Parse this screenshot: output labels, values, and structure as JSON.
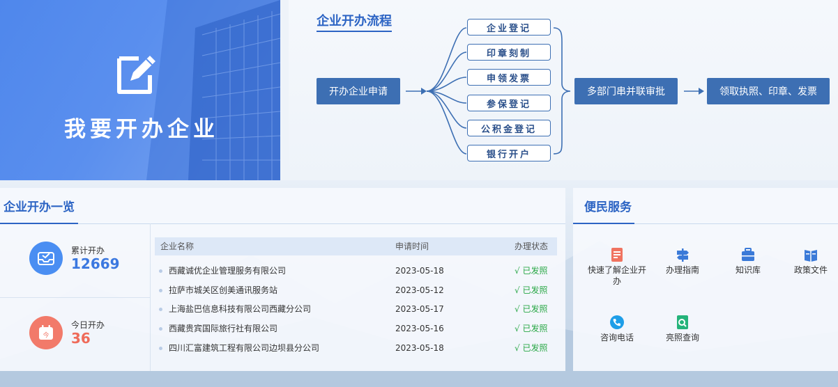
{
  "banner": {
    "title": "我要开办企业",
    "icon": "pen-edit-icon"
  },
  "flow": {
    "title": "企业开办流程",
    "start": "开办企业申请",
    "steps": [
      "企业登记",
      "印章刻制",
      "申领发票",
      "参保登记",
      "公积金登记",
      "银行开户"
    ],
    "review": "多部门串并联审批",
    "result": "领取执照、印章、发票"
  },
  "overview": {
    "title": "企业开办一览",
    "total": {
      "label": "累计开办",
      "value": "12669",
      "icon": "inbox-check-icon",
      "color": "#4a8ef2"
    },
    "today": {
      "label": "今日开办",
      "value": "36",
      "icon": "calendar-today-icon",
      "color": "#f27a6a"
    },
    "columns": [
      "企业名称",
      "申请时间",
      "办理状态"
    ],
    "rows": [
      {
        "name": "西藏诚优企业管理服务有限公司",
        "date": "2023-05-18",
        "status": "√ 已发照"
      },
      {
        "name": "拉萨市城关区创美通讯服务站",
        "date": "2023-05-12",
        "status": "√ 已发照"
      },
      {
        "name": "上海盐巴信息科技有限公司西藏分公司",
        "date": "2023-05-17",
        "status": "√ 已发照"
      },
      {
        "name": "西藏贵宾国际旅行社有限公司",
        "date": "2023-05-16",
        "status": "√ 已发照"
      },
      {
        "name": "四川汇富建筑工程有限公司边坝县分公司",
        "date": "2023-05-18",
        "status": "√ 已发照"
      }
    ]
  },
  "services": {
    "title": "便民服务",
    "items": [
      {
        "label": "快速了解企业开办",
        "icon": "document-icon",
        "color": "#f07360"
      },
      {
        "label": "办理指南",
        "icon": "signpost-icon",
        "color": "#3b7ad8"
      },
      {
        "label": "知识库",
        "icon": "toolbox-icon",
        "color": "#3b7ad8"
      },
      {
        "label": "政策文件",
        "icon": "book-icon",
        "color": "#3b7ad8"
      },
      {
        "label": "咨询电话",
        "icon": "phone-icon",
        "color": "#1e9ee8"
      },
      {
        "label": "亮照查询",
        "icon": "license-search-icon",
        "color": "#24b37a"
      }
    ]
  }
}
